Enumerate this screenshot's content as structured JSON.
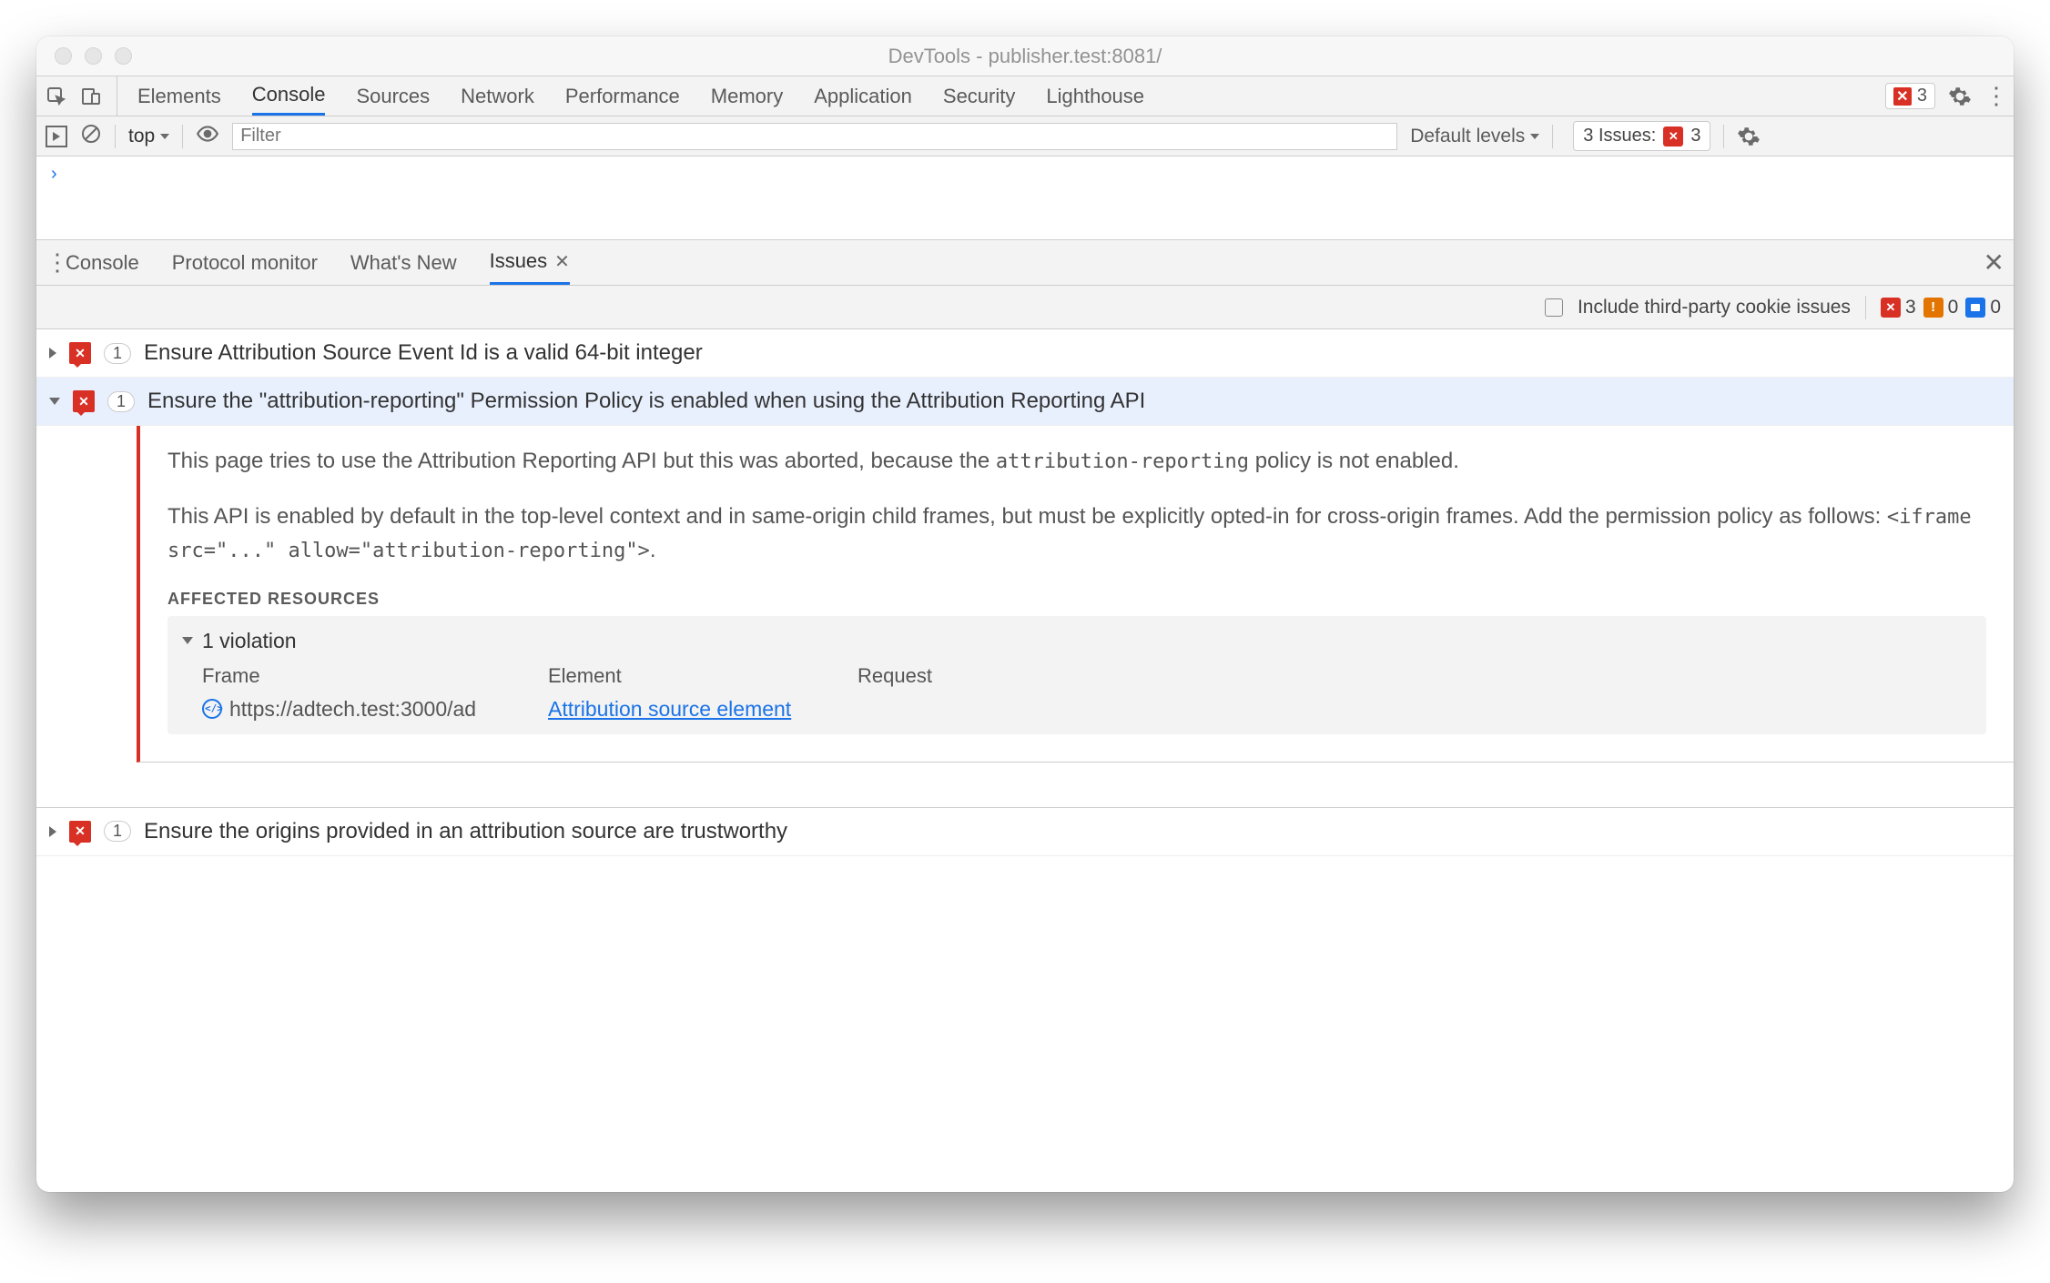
{
  "window": {
    "title": "DevTools - publisher.test:8081/"
  },
  "mainTabs": {
    "tab0": "Elements",
    "tab1": "Console",
    "tab2": "Sources",
    "tab3": "Network",
    "tab4": "Performance",
    "tab5": "Memory",
    "tab6": "Application",
    "tab7": "Security",
    "tab8": "Lighthouse"
  },
  "errorCount": "3",
  "consoleToolbar": {
    "context": "top",
    "filterPlaceholder": "Filter",
    "levels": "Default levels",
    "issuesLabel": "3 Issues:",
    "issuesCount": "3"
  },
  "consolePrompt": "›",
  "drawerTabs": {
    "tab0": "Console",
    "tab1": "Protocol monitor",
    "tab2": "What's New",
    "tab3": "Issues"
  },
  "issuesSub": {
    "checkboxLabel": "Include third-party cookie issues",
    "red": "3",
    "yellow": "0",
    "blue": "0"
  },
  "issues": {
    "row0": {
      "count": "1",
      "title": "Ensure Attribution Source Event Id is a valid 64-bit integer"
    },
    "row1": {
      "count": "1",
      "title": "Ensure the \"attribution-reporting\" Permission Policy is enabled when using the Attribution Reporting API",
      "desc1a": "This page tries to use the Attribution Reporting API but this was aborted, because the ",
      "desc1code": "attribution-reporting",
      "desc1b": " policy is not enabled.",
      "desc2a": "This API is enabled by default in the top-level context and in same-origin child frames, but must be explicitly opted-in for cross-origin frames. Add the permission policy as follows: ",
      "desc2code": "<iframe src=\"...\" allow=\"attribution-reporting\">",
      "desc2b": ".",
      "affectedLabel": "AFFECTED RESOURCES",
      "violationCount": "1 violation",
      "headers": {
        "frame": "Frame",
        "element": "Element",
        "request": "Request"
      },
      "frameUrl": "https://adtech.test:3000/ad",
      "elementLink": "Attribution source element"
    },
    "row2": {
      "count": "1",
      "title": "Ensure the origins provided in an attribution source are trustworthy"
    }
  }
}
